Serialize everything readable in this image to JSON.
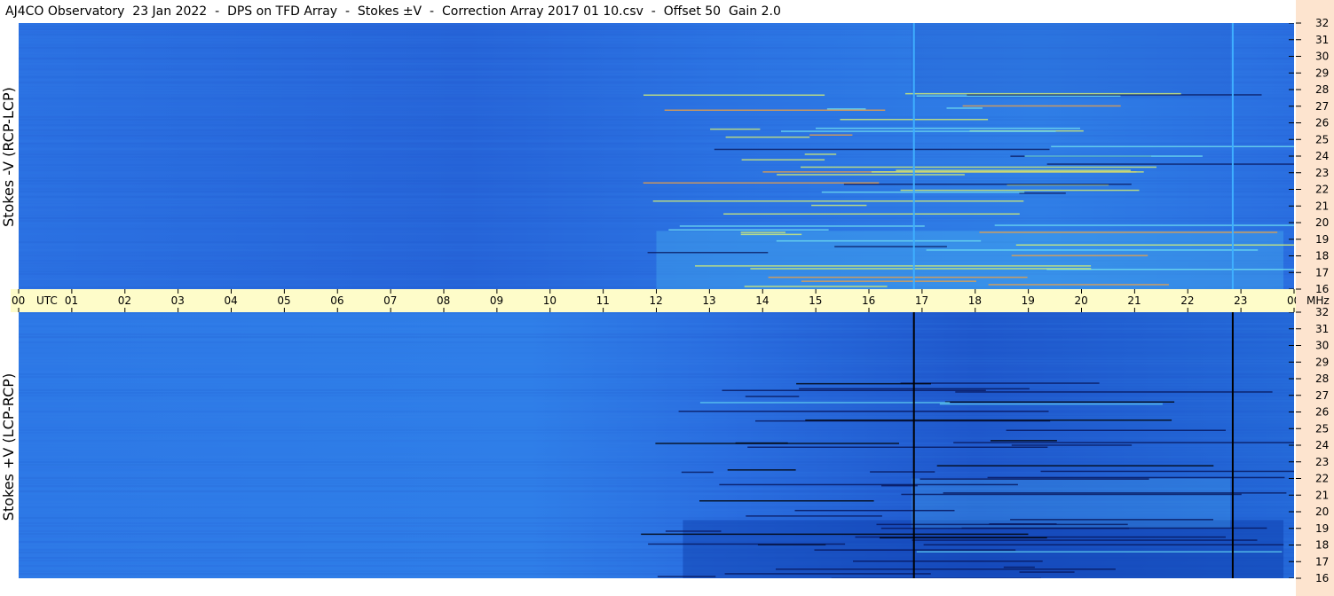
{
  "title": "AJ4CO Observatory  23 Jan 2022  -  DPS on TFD Array  -  Stokes ±V  -  Correction Array 2017 01 10.csv  -  Offset 50  Gain 2.0",
  "chart_data": [
    {
      "type": "heatmap",
      "panel": "top",
      "ylabel": "Stokes -V (RCP-LCP)",
      "y_axis_unit": "MHz",
      "y_ticks": [
        "32",
        "31",
        "30",
        "29",
        "28",
        "27",
        "26",
        "25",
        "24",
        "23",
        "22",
        "21",
        "20",
        "19",
        "18",
        "17",
        "16"
      ],
      "ylim": [
        16,
        32
      ],
      "x_ticks": [
        "00",
        "01",
        "02",
        "03",
        "04",
        "05",
        "06",
        "07",
        "08",
        "09",
        "10",
        "11",
        "12",
        "13",
        "14",
        "15",
        "16",
        "17",
        "18",
        "19",
        "20",
        "21",
        "22",
        "23",
        "00"
      ],
      "xlim_hours_utc": [
        0,
        24
      ],
      "vertical_lines_utc_hours": [
        16.83,
        22.83
      ],
      "colors": {
        "base": "#2a6ee0",
        "bright": "#45b5f0",
        "burst": "#d8f070",
        "line": "#3fb0ff"
      }
    },
    {
      "type": "heatmap",
      "panel": "bottom",
      "ylabel": "Stokes +V (LCP-RCP)",
      "y_axis_unit": "MHz",
      "y_ticks": [
        "32",
        "31",
        "30",
        "29",
        "28",
        "27",
        "26",
        "25",
        "24",
        "23",
        "22",
        "21",
        "20",
        "19",
        "18",
        "17",
        "16"
      ],
      "ylim": [
        16,
        32
      ],
      "x_ticks": [
        "00",
        "01",
        "02",
        "03",
        "04",
        "05",
        "06",
        "07",
        "08",
        "09",
        "10",
        "11",
        "12",
        "13",
        "14",
        "15",
        "16",
        "17",
        "18",
        "19",
        "20",
        "21",
        "22",
        "23",
        "00"
      ],
      "xlim_hours_utc": [
        0,
        24
      ],
      "vertical_lines_utc_hours": [
        16.83,
        22.83
      ],
      "colors": {
        "base": "#2a74e4",
        "dark": "#1048b8",
        "line": "#000000"
      }
    }
  ],
  "time_axis": {
    "utc_label": "UTC",
    "mhz_label": "MHz"
  }
}
